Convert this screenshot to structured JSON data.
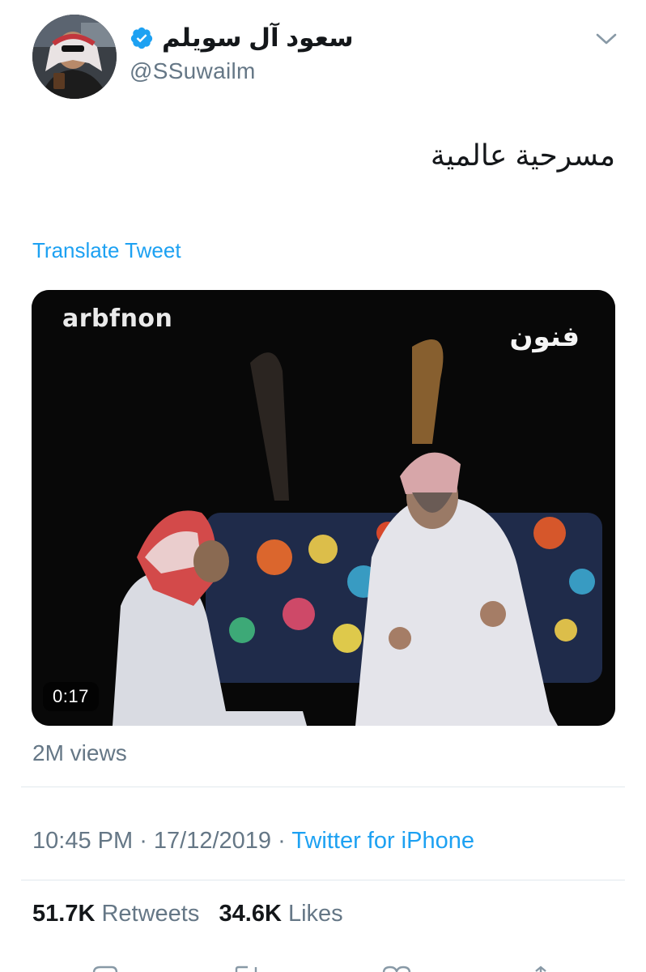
{
  "author": {
    "display_name": "سعود آل سويلم",
    "handle": "@SSuwailm",
    "verified": true
  },
  "tweet": {
    "text": "مسرحية عالمية",
    "translate_label": "Translate Tweet"
  },
  "media": {
    "watermark_left": "arbfnon",
    "watermark_right": "فنون",
    "duration": "0:17"
  },
  "views": "2M views",
  "meta": {
    "time": "10:45 PM",
    "separator": " · ",
    "date": "17/12/2019",
    "source": "Twitter for iPhone"
  },
  "stats": {
    "retweets_count": "51.7K",
    "retweets_label": "Retweets",
    "likes_count": "34.6K",
    "likes_label": "Likes"
  },
  "icons": {
    "verified": "verified-badge-icon",
    "caret": "chevron-down-icon"
  },
  "colors": {
    "accent": "#1da1f2",
    "secondary_text": "#657786",
    "primary_text": "#14171a",
    "divider": "#e1e8ed"
  }
}
